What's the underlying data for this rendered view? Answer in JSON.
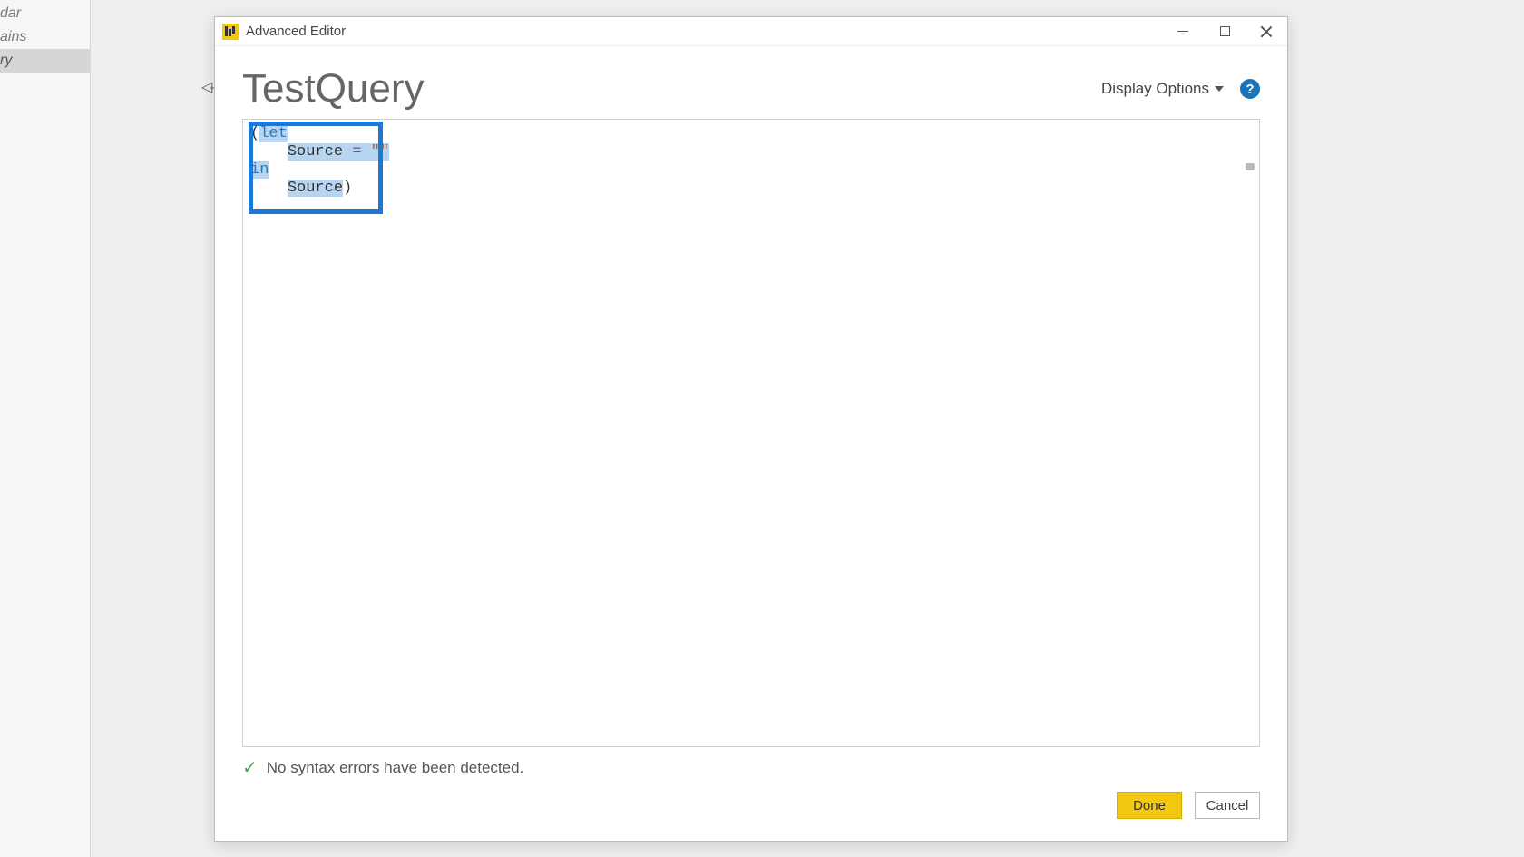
{
  "sidebar": {
    "items": [
      {
        "label": "dar"
      },
      {
        "label": "ains"
      },
      {
        "label": "ry"
      }
    ],
    "selected_index": 2
  },
  "dialog": {
    "title": "Advanced Editor",
    "query_name": "TestQuery",
    "display_options_label": "Display Options",
    "help_glyph": "?",
    "code": {
      "line1_open": "(",
      "line1_kw": "let",
      "line2_ident": "Source",
      "line2_op": " = ",
      "line2_str": "\"\"",
      "line3_kw": "in",
      "line4_ident": "Source",
      "line4_close": ")"
    },
    "status_text": "No syntax errors have been detected.",
    "buttons": {
      "done": "Done",
      "cancel": "Cancel"
    }
  }
}
